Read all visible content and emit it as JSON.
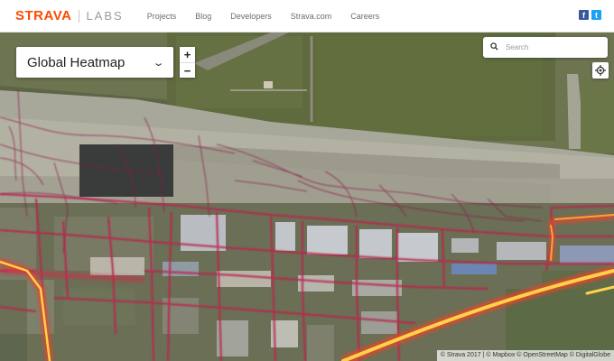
{
  "header": {
    "brand": "STRAVA",
    "brand_sub": "LABS",
    "nav": [
      "Projects",
      "Blog",
      "Developers",
      "Strava.com",
      "Careers"
    ],
    "social": {
      "facebook": "f",
      "twitter": "t"
    }
  },
  "controls": {
    "layer_select": "Global Heatmap",
    "zoom_in": "+",
    "zoom_out": "−",
    "search_placeholder": "Search"
  },
  "attribution": "© Strava 2017 | © Mapbox © OpenStreetMap © DigitalGlobe",
  "colors": {
    "brand": "#fc4c02",
    "heat_low": "#8a1c4e",
    "heat_mid": "#e8452c",
    "heat_high": "#ffd24a"
  },
  "icons": {
    "search": "search-icon",
    "locate": "locate-icon",
    "chevron": "chevron-down-icon"
  }
}
